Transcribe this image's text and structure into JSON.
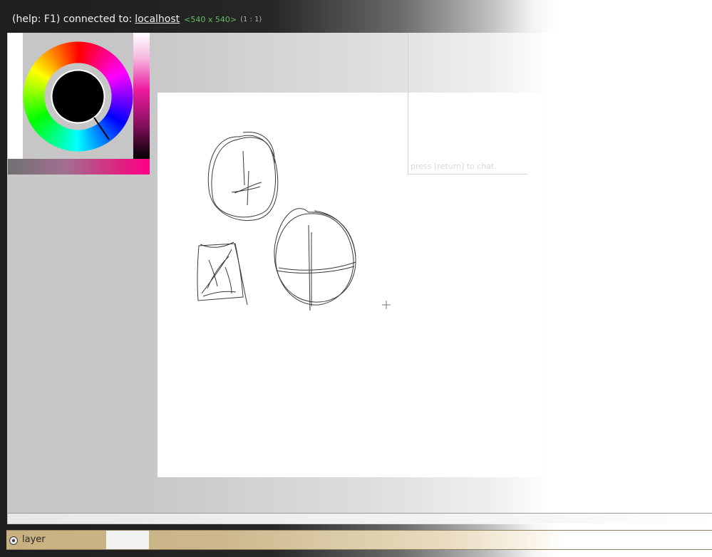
{
  "titlebar": {
    "prefix": "(help: F1) connected to:",
    "host": "localhost",
    "dimensions": "<540 x 540>",
    "zoom_ratio": "(1 : 1)"
  },
  "chat": {
    "placeholder": "press [return] to chat."
  },
  "palette": {
    "current_color": "#000000",
    "accent_color": "#ff008c",
    "icon": "color-wheel-icon"
  },
  "layers": [
    {
      "label": "layer",
      "visible": true,
      "icon": "eye-icon"
    }
  ],
  "canvas": {
    "icon": "crosshair-cursor-icon"
  }
}
